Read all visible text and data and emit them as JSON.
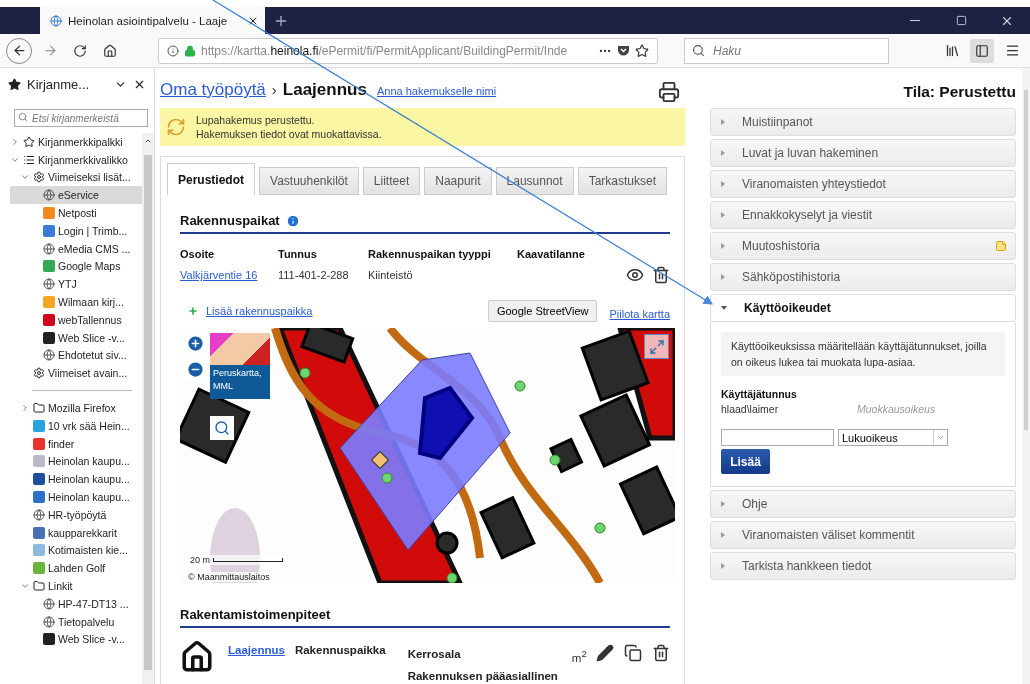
{
  "browser": {
    "tab": {
      "title": "Heinolan asiointipalvelu - Laaje"
    },
    "url": {
      "prefix": "https://kartta.",
      "domain": "heinola.fi",
      "path": "/ePermit/fi/PermitApplicant/BuildingPermit/Inde"
    },
    "search": {
      "placeholder": "Haku"
    }
  },
  "sidebar": {
    "title": "Kirjanme...",
    "search": {
      "placeholder": "Etsi kirjanmerkeistä"
    },
    "items": [
      {
        "kind": "starfolder",
        "label": "Kirjanmerkkipalkki",
        "expanded": false,
        "selected": false
      },
      {
        "kind": "menufolder",
        "label": "Kirjanmerkkivalikko",
        "expanded": true,
        "selected": false,
        "children": [
          {
            "kind": "gear",
            "label": "Viimeiseksi lisät...",
            "expanded": true,
            "selected": false,
            "children": [
              {
                "kind": "globe",
                "label": "eService",
                "selected": true
              },
              {
                "kind": "tile",
                "label": "Netposti",
                "color": "#f08a1c",
                "selected": false
              },
              {
                "kind": "tile",
                "label": "Login | Trimb...",
                "color": "#3a7bd5",
                "selected": false
              },
              {
                "kind": "globe",
                "label": "eMedia CMS ...",
                "selected": false
              },
              {
                "kind": "tile",
                "label": "Google Maps",
                "color": "#34a853",
                "selected": false
              },
              {
                "kind": "globe",
                "label": "YTJ",
                "selected": false
              },
              {
                "kind": "tile",
                "label": "Wilmaan kirj...",
                "color": "#f5a623",
                "selected": false
              },
              {
                "kind": "tile",
                "label": "webTallennus",
                "color": "#d0021b",
                "selected": false
              },
              {
                "kind": "tile",
                "label": "Web Slice -v...",
                "color": "#222222",
                "selected": false
              },
              {
                "kind": "globe",
                "label": "Ehdotetut siv...",
                "selected": false
              }
            ]
          },
          {
            "kind": "gear",
            "label": "Viimeiset avain...",
            "selected": false
          },
          {
            "kind": "separator"
          },
          {
            "kind": "folder",
            "label": "Mozilla Firefox",
            "expanded": false,
            "selected": false
          },
          {
            "kind": "tile",
            "label": "10 vrk sää Hein...",
            "color": "#29a3e0",
            "selected": false
          },
          {
            "kind": "tile",
            "label": "finder",
            "color": "#e8322b",
            "selected": false
          },
          {
            "kind": "tile",
            "label": "Heinolan kaupu...",
            "color": "#b9b9c9",
            "selected": false
          },
          {
            "kind": "tile",
            "label": "Heinolan kaupu...",
            "color": "#1f4e9c",
            "selected": false
          },
          {
            "kind": "tile",
            "label": "Heinolan kaupu...",
            "color": "#2a72c8",
            "selected": false
          },
          {
            "kind": "globe",
            "label": "HR-työpöytä",
            "selected": false
          },
          {
            "kind": "tile",
            "label": "kaupparekkarit",
            "color": "#4a6fb5",
            "selected": false
          },
          {
            "kind": "tile",
            "label": "Kotimaisten kie...",
            "color": "#8fb8e0",
            "selected": false
          },
          {
            "kind": "tile",
            "label": "Lahden Golf",
            "color": "#6bb33a",
            "selected": false
          },
          {
            "kind": "folder",
            "label": "Linkit",
            "expanded": true,
            "selected": false,
            "children": [
              {
                "kind": "globe",
                "label": "HP-47-DT13 ...",
                "selected": false
              },
              {
                "kind": "globe",
                "label": "Tietopalvelu",
                "selected": false
              },
              {
                "kind": "tile",
                "label": "Web Slice -v...",
                "color": "#222222",
                "selected": false
              }
            ]
          }
        ]
      }
    ]
  },
  "page": {
    "breadcrumb": {
      "parent": "Oma työpöytä",
      "separator": "›",
      "current": "Laajennus",
      "rename_link": "Anna hakemukselle nimi"
    },
    "notice": [
      "Lupahakemus perustettu.",
      "Hakemuksen tiedot ovat muokattavissa."
    ],
    "tabs": [
      {
        "label": "Perustiedot",
        "selected": true
      },
      {
        "label": "Vastuuhenkilöt",
        "selected": false
      },
      {
        "label": "Liitteet",
        "selected": false
      },
      {
        "label": "Naapurit",
        "selected": false
      },
      {
        "label": "Lausunnot",
        "selected": false
      },
      {
        "label": "Tarkastukset",
        "selected": false
      }
    ],
    "building_sites": {
      "title": "Rakennuspaikat",
      "columns": [
        "Osoite",
        "Tunnus",
        "Rakennuspaikan tyyppi",
        "Kaavatilanne"
      ],
      "rows": [
        {
          "address": "Valkjärventie 16",
          "id": "111-401-2-288",
          "type": "Kiinteistö"
        }
      ],
      "add_link": "Lisää rakennuspaikka",
      "streetview_button": "Google StreetView",
      "hide_map_link": "Piilota kartta",
      "map": {
        "layer_label": "Peruskartta, MML",
        "scale": "20 m",
        "copyright": "© Maanmittauslaitos"
      }
    },
    "operations": {
      "title": "Rakentamistoimenpiteet",
      "rows": [
        {
          "operation": "Laajennus",
          "site": "Rakennuspaikka",
          "area_label": "Kerrosala",
          "area_unit": "m$^{2}$",
          "purpose_label": "Rakennuksen pääasiallinen"
        }
      ]
    }
  },
  "status": "Tila: Perustettu",
  "panels": [
    {
      "label": "Muistiinpanot",
      "expanded": false,
      "note": false
    },
    {
      "label": "Luvat ja luvan hakeminen",
      "expanded": false,
      "note": false
    },
    {
      "label": "Viranomaisten yhteystiedot",
      "expanded": false,
      "note": false
    },
    {
      "label": "Ennakkokyselyt ja viestit",
      "expanded": false,
      "note": false
    },
    {
      "label": "Muutoshistoria",
      "expanded": false,
      "note": true
    },
    {
      "label": "Sähköpostihistoria",
      "expanded": false,
      "note": false
    },
    {
      "label": "Käyttöoikeudet",
      "expanded": true,
      "note": false
    },
    {
      "label": "Ohje",
      "expanded": false,
      "note": false
    },
    {
      "label": "Viranomaisten väliset kommentit",
      "expanded": false,
      "note": false
    },
    {
      "label": "Tarkista hankkeen tiedot",
      "expanded": false,
      "note": false
    }
  ],
  "permissions": {
    "intro": "Käyttöoikeuksissa määritellään käyttäjätunnukset, joilla on oikeus lukea tai muokata lupa-asiaa.",
    "column_label": "Käyttäjätunnus",
    "users": [
      {
        "name": "hlaad\\laimer",
        "right": "Muokkausoikeus"
      }
    ],
    "select_value": "Lukuoikeus",
    "add_button": "Lisää"
  }
}
